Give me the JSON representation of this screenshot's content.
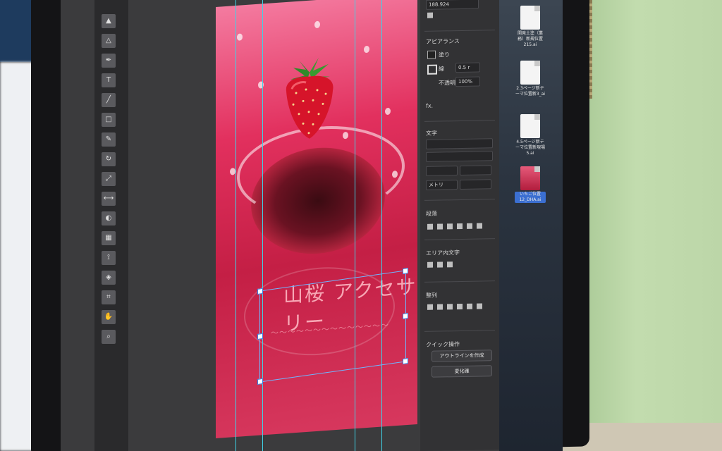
{
  "app": {
    "artboard": {
      "title_text": "山桜 アクセサリー",
      "subtitle_text": "〜〜〜〜〜〜〜〜〜〜〜〜〜〜"
    },
    "properties": {
      "top_value": "188.924",
      "section_appearance": "アピアランス",
      "fill_label": "塗り",
      "stroke_label": "線",
      "stroke_value": "0.5 r",
      "opacity_label": "不透明度",
      "opacity_value": "100%",
      "fx_label": "fx.",
      "section_character": "文字",
      "metric_label": "メトリ",
      "section_paragraph": "段落",
      "section_area_type": "エリア内文字",
      "section_align": "整列",
      "section_quick_actions": "クイック操作",
      "create_outlines_button": "アウトラインを作成",
      "transform_button": "変化確"
    },
    "desktop_files": [
      {
        "name": "開発土塗（業務）新規位置215.ai",
        "thumb": "doc"
      },
      {
        "name": "2.3ページ新テーマ位置新3_ai",
        "thumb": "doc"
      },
      {
        "name": "4.5ページ新テーマ位置新現場5.ai",
        "thumb": "doc"
      },
      {
        "name": "いちご位置12_DHA.ai",
        "thumb": "image",
        "selected": true
      }
    ],
    "colors": {
      "guide": "#3fd2e6",
      "artboard_red": "#c41f45",
      "selection_blue": "#6fb6ff"
    }
  }
}
